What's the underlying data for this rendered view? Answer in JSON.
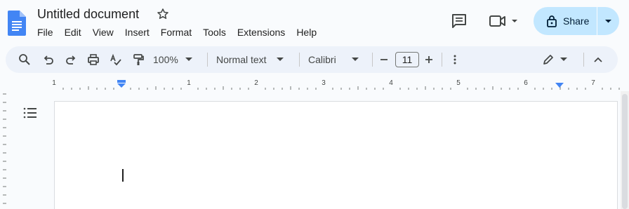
{
  "document": {
    "title": "Untitled document"
  },
  "menu": [
    "File",
    "Edit",
    "View",
    "Insert",
    "Format",
    "Tools",
    "Extensions",
    "Help"
  ],
  "header": {
    "share_label": "Share"
  },
  "toolbar": {
    "zoom": "100%",
    "style": "Normal text",
    "font": "Calibri",
    "font_size": "11"
  },
  "ruler": {
    "numbers": [
      "1",
      "1",
      "2",
      "3",
      "4",
      "5",
      "6",
      "7"
    ]
  },
  "colors": {
    "share_bg": "#c2e7ff",
    "toolbar_bg": "#edf2fa",
    "docs_blue": "#4285f4",
    "ruler_marker": "#4285f4"
  }
}
